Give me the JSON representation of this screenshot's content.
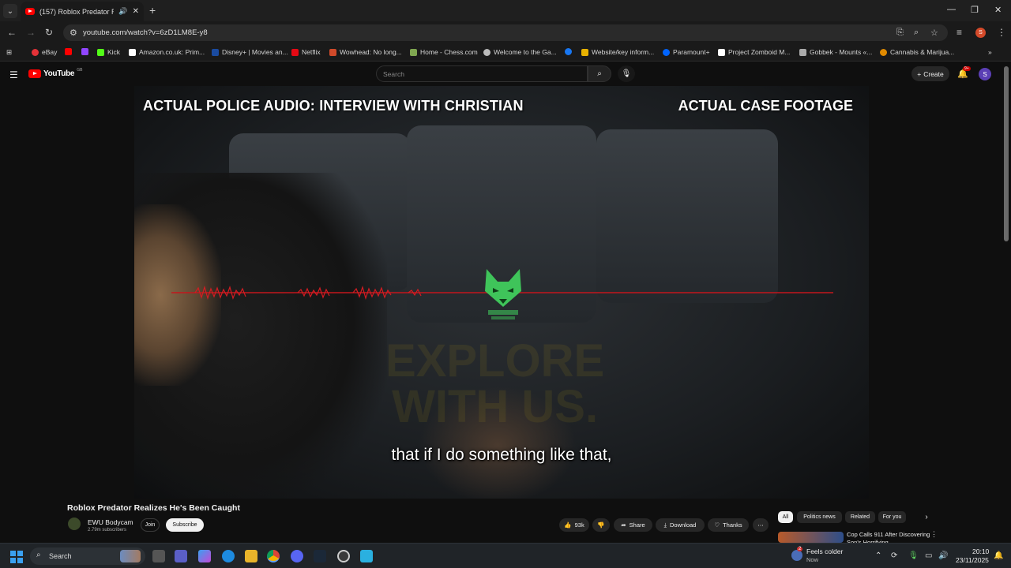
{
  "browser": {
    "tab_title": "(157) Roblox Predator Reali...",
    "url": "youtube.com/watch?v=6zD1LM8E-y8",
    "bookmarks": [
      {
        "label": "eBay",
        "color": "#e53238"
      },
      {
        "label": "",
        "color": "#ff0000"
      },
      {
        "label": "",
        "color": "#9146ff"
      },
      {
        "label": "Kick",
        "color": "#53fc18"
      },
      {
        "label": "Amazon.co.uk: Prim...",
        "color": "#ffffff"
      },
      {
        "label": "Disney+ | Movies an...",
        "color": "#1a4ba0"
      },
      {
        "label": "Netflix",
        "color": "#e50914"
      },
      {
        "label": "Wowhead: No long...",
        "color": "#d04a2a"
      },
      {
        "label": "Home - Chess.com",
        "color": "#7fa650"
      },
      {
        "label": "Welcome to the Ga...",
        "color": "#bbbbbb"
      },
      {
        "label": "",
        "color": "#1877f2"
      },
      {
        "label": "Website/key inform...",
        "color": "#e8b100"
      },
      {
        "label": "Paramount+",
        "color": "#0064ff"
      },
      {
        "label": "Project Zomboid M...",
        "color": "#ffffff"
      },
      {
        "label": "Gobbek - Mounts «...",
        "color": "#aaaaaa"
      },
      {
        "label": "Cannabis & Marijua...",
        "color": "#e08a00"
      }
    ]
  },
  "youtube": {
    "logo_text": "YouTube",
    "region": "GB",
    "search_placeholder": "Search",
    "create_label": "Create",
    "notif_count": "9+",
    "avatar_initial": "S"
  },
  "video": {
    "overlay_left": "ACTUAL POLICE AUDIO: INTERVIEW WITH CHRISTIAN",
    "overlay_right": "ACTUAL CASE FOOTAGE",
    "watermark": "EXPLORE\nWITH US.",
    "subtitle": "that if I do something like that,",
    "title": "Roblox Predator Realizes He's Been Caught",
    "channel": "EWU Bodycam",
    "subscribers": "2.79m subscribers",
    "join_label": "Join",
    "subscribe_label": "Subscribe",
    "likes": "93k",
    "share_label": "Share",
    "download_label": "Download",
    "thanks_label": "Thanks"
  },
  "chips": [
    "All",
    "Politics news",
    "Related",
    "For you"
  ],
  "recommendation": {
    "title": "Cop Calls 911 After Discovering Son's Horrifying"
  },
  "taskbar": {
    "search_label": "Search",
    "weather_title": "Feels colder",
    "weather_sub": "Now",
    "weather_badge": "2",
    "time": "20:10",
    "date": "23/11/2025"
  }
}
